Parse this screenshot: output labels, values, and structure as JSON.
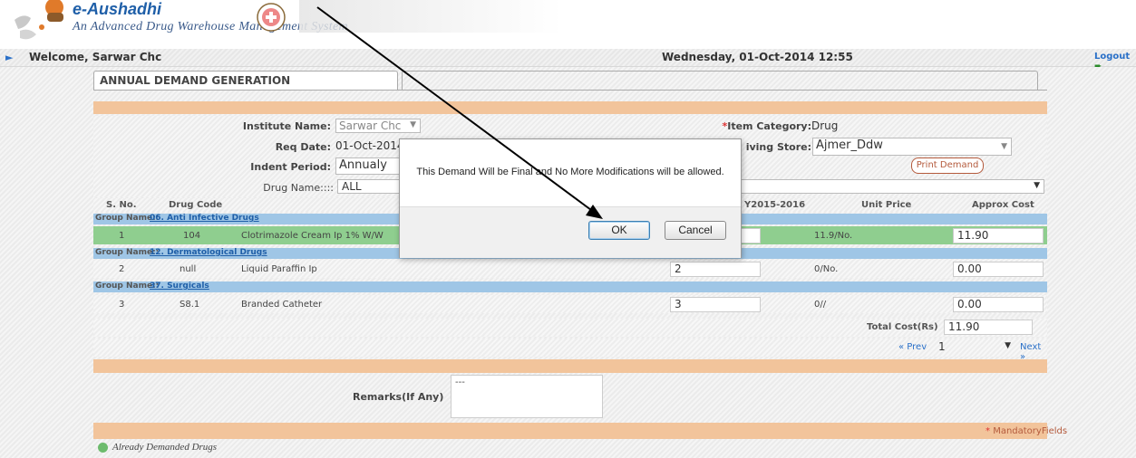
{
  "header": {
    "title": "e-Aushadhi",
    "subtitle": "An Advanced Drug Warehouse Management System"
  },
  "welcome_bar": {
    "welcome": "Welcome, Sarwar Chc",
    "datetime": "Wednesday, 01-Oct-2014 12:55",
    "logout": "Logout"
  },
  "tab": {
    "label": "ANNUAL DEMAND GENERATION"
  },
  "form": {
    "institute_label": "Institute Name:",
    "institute_value": "Sarwar Chc",
    "item_category_star": "*",
    "item_category_label": "Item Category:",
    "item_category_value": "Drug",
    "req_date_label": "Req Date:",
    "req_date_value": "01-Oct-2014",
    "store_label": "iving Store:",
    "store_value": "Ajmer_Ddw",
    "indent_label": "Indent Period:",
    "indent_value": "Annualy",
    "print_button": "Print Demand",
    "drug_name_label": "Drug Name::::",
    "drug_name_value": "ALL"
  },
  "table": {
    "headers": {
      "sno": "S. No.",
      "code": "Drug Code",
      "fy": "Y2015-2016",
      "unit_price": "Unit Price",
      "approx_cost": "Approx Cost"
    },
    "group_prefix": "Group Name::",
    "groups": [
      {
        "name": "06. Anti Infective Drugs",
        "row": {
          "sno": "1",
          "code": "104",
          "drug": "Clotrimazole Cream Ip 1% W/W",
          "qty": "",
          "unit_price": "11.9/No.",
          "cost": "11.90"
        }
      },
      {
        "name": "12. Dermatological Drugs",
        "row": {
          "sno": "2",
          "code": "null",
          "drug": "Liquid Paraffin Ip",
          "qty": "2",
          "unit_price": "0/No.",
          "cost": "0.00"
        }
      },
      {
        "name": "37. Surgicals",
        "row": {
          "sno": "3",
          "code": "S8.1",
          "drug": "Branded Catheter",
          "qty": "3",
          "unit_price": "0//",
          "cost": "0.00"
        }
      }
    ],
    "total_label": "Total Cost(Rs)",
    "total_value": "11.90"
  },
  "pager": {
    "prev": "« Prev",
    "page": "1",
    "next": "Next »"
  },
  "remarks": {
    "label": "Remarks(If Any)",
    "value": "---"
  },
  "footer": {
    "mandatory_star": "*",
    "mandatory": "MandatoryFields",
    "legend": "Already Demanded Drugs"
  },
  "dialog": {
    "message": "This Demand Will be Final and No More Modifications will be allowed.",
    "ok": "OK",
    "cancel": "Cancel"
  },
  "colors": {
    "orange_strip": "#f2c49b",
    "group_row": "#9fc6e6",
    "demanded_row": "#8fce8f",
    "link_blue": "#1f5fa8"
  },
  "icons": [
    "app-logo-icon",
    "emblem-icon",
    "nav-arrow-icon",
    "logout-icon",
    "dropdown-arrow-icon",
    "legend-dot-icon"
  ]
}
